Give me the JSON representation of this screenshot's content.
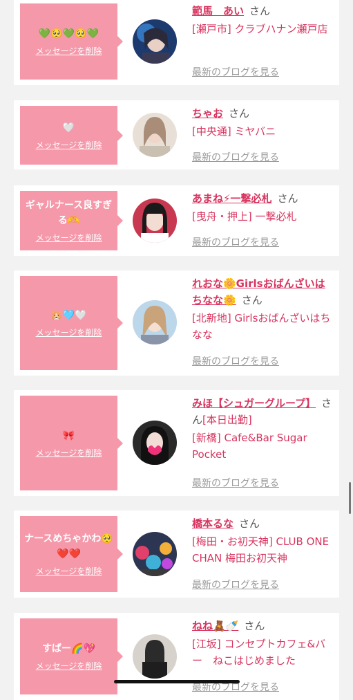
{
  "cards": [
    {
      "message": "💚🥺💚🥺💚",
      "delete_label": "メッセージを削除",
      "name": "範馬　あい",
      "honorific": "さん",
      "shop": "[瀬戸市] クラブハナン瀬戸店",
      "blog_label": "最新のブログを見る"
    },
    {
      "message": "🤍",
      "delete_label": "メッセージを削除",
      "name": "ちゃお",
      "honorific": "さん",
      "shop": "[中央通] ミヤバニ",
      "blog_label": "最新のブログを見る"
    },
    {
      "message": "ギャルナース良すぎる🫶",
      "delete_label": "メッセージを削除",
      "name": "あまね⚡一撃必札",
      "honorific": "さん",
      "shop": "[曳舟・押上] 一撃必札",
      "blog_label": "最新のブログを見る"
    },
    {
      "message": "🐹🩵🤍",
      "delete_label": "メッセージを削除",
      "name": "れおな🌼Girlsおばんざいはちなな🌼",
      "honorific": "さん",
      "shop": "[北新地] Girlsおばんざいはちなな",
      "blog_label": "最新のブログを見る"
    },
    {
      "message": "🎀",
      "delete_label": "メッセージを削除",
      "name": "みほ【シュガーグループ】",
      "honorific": "さん",
      "shop_prefix": "[本日出勤]",
      "shop": "[新橋] Cafe&Bar Sugar Pocket",
      "blog_label": "最新のブログを見る"
    },
    {
      "message": "ナースめちゃかわ🥺❤️❤️",
      "delete_label": "メッセージを削除",
      "name": "橋本るな",
      "honorific": "さん",
      "shop": "[梅田・お初天神] CLUB ONE CHAN 梅田お初天神",
      "blog_label": "最新のブログを見る"
    },
    {
      "message": "すばー🌈💖",
      "delete_label": "メッセージを削除",
      "name": "ねね🧸🍼",
      "honorific": "さん",
      "shop": "[江坂] コンセプトカフェ&バー　ねこはじめました",
      "blog_label": "最新のブログを見る"
    }
  ],
  "colors": {
    "accent": "#d8345f",
    "bubble": "#f598aa",
    "background": "#f2f2f2"
  }
}
